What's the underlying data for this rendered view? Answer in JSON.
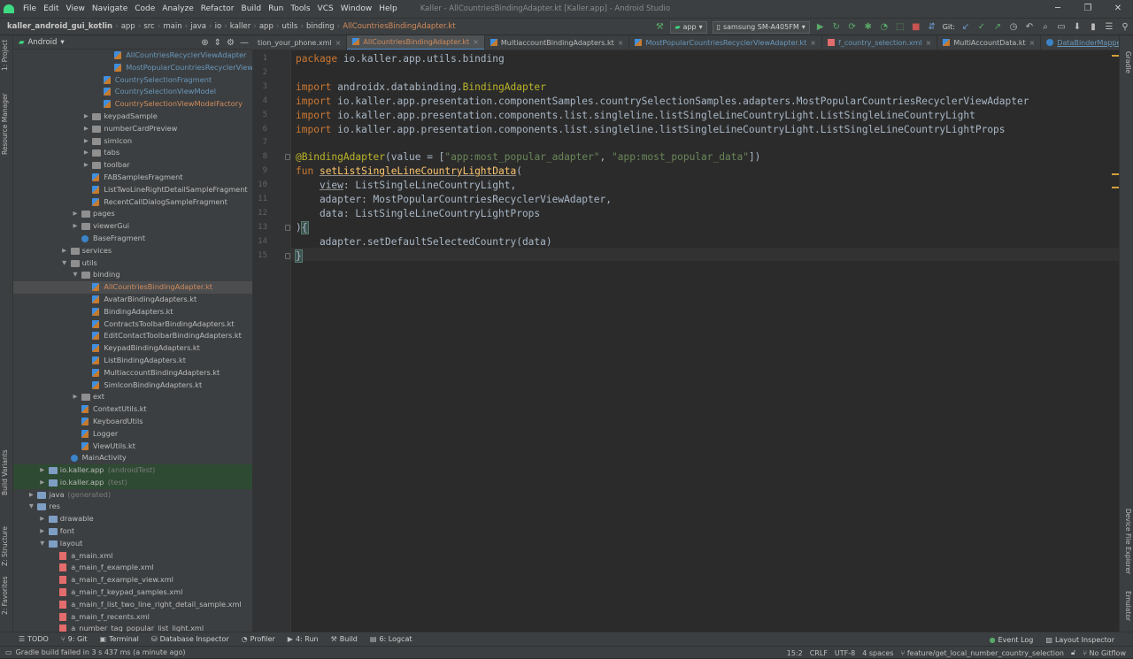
{
  "menubar": {
    "items": [
      "File",
      "Edit",
      "View",
      "Navigate",
      "Code",
      "Analyze",
      "Refactor",
      "Build",
      "Run",
      "Tools",
      "VCS",
      "Window",
      "Help"
    ],
    "window_title": "Kaller - AllCountriesBindingAdapter.kt [Kaller.app] - Android Studio"
  },
  "breadcrumbs": [
    "kaller_android_gui_kotlin",
    "app",
    "src",
    "main",
    "java",
    "io",
    "kaller",
    "app",
    "utils",
    "binding",
    "AllCountriesBindingAdapter.kt"
  ],
  "toolbar": {
    "run_config": "app",
    "device": "samsung SM-A405FM",
    "git_label": "Git:"
  },
  "project_panel": {
    "view_mode": "Android",
    "rows": [
      {
        "label": "AllCountriesRecyclerViewAdapter",
        "indent": 8,
        "icon": "kt",
        "color": "blue",
        "arrow": ""
      },
      {
        "label": "MostPopularCountriesRecyclerViewAdapte",
        "indent": 8,
        "icon": "kt",
        "color": "blue",
        "arrow": ""
      },
      {
        "label": "CountrySelectionFragment",
        "indent": 7,
        "icon": "kt",
        "color": "blue",
        "arrow": ""
      },
      {
        "label": "CountrySelectionViewModel",
        "indent": 7,
        "icon": "kt",
        "color": "blue",
        "arrow": ""
      },
      {
        "label": "CountrySelectionViewModelFactory",
        "indent": 7,
        "icon": "kt",
        "color": "orange",
        "arrow": ""
      },
      {
        "label": "keypadSample",
        "indent": 6,
        "icon": "folder",
        "color": "",
        "arrow": "▶"
      },
      {
        "label": "numberCardPreview",
        "indent": 6,
        "icon": "folder",
        "color": "",
        "arrow": "▶"
      },
      {
        "label": "simIcon",
        "indent": 6,
        "icon": "folder",
        "color": "",
        "arrow": "▶"
      },
      {
        "label": "tabs",
        "indent": 6,
        "icon": "folder",
        "color": "",
        "arrow": "▶"
      },
      {
        "label": "toolbar",
        "indent": 6,
        "icon": "folder",
        "color": "",
        "arrow": "▶"
      },
      {
        "label": "FABSamplesFragment",
        "indent": 6,
        "icon": "kt",
        "color": "",
        "arrow": ""
      },
      {
        "label": "ListTwoLineRightDetailSampleFragment",
        "indent": 6,
        "icon": "kt",
        "color": "",
        "arrow": ""
      },
      {
        "label": "RecentCallDialogSampleFragment",
        "indent": 6,
        "icon": "kt",
        "color": "",
        "arrow": ""
      },
      {
        "label": "pages",
        "indent": 5,
        "icon": "folder",
        "color": "",
        "arrow": "▶"
      },
      {
        "label": "viewerGui",
        "indent": 5,
        "icon": "folder",
        "color": "",
        "arrow": "▶"
      },
      {
        "label": "BaseFragment",
        "indent": 5,
        "icon": "cls",
        "color": "",
        "arrow": ""
      },
      {
        "label": "services",
        "indent": 4,
        "icon": "folder",
        "color": "",
        "arrow": "▶"
      },
      {
        "label": "utils",
        "indent": 4,
        "icon": "folder",
        "color": "",
        "arrow": "▼"
      },
      {
        "label": "binding",
        "indent": 5,
        "icon": "folder",
        "color": "",
        "arrow": "▼"
      },
      {
        "label": "AllCountriesBindingAdapter.kt",
        "indent": 6,
        "icon": "kt",
        "color": "orange",
        "arrow": "",
        "selected": true
      },
      {
        "label": "AvatarBindingAdapters.kt",
        "indent": 6,
        "icon": "kt",
        "color": "",
        "arrow": ""
      },
      {
        "label": "BindingAdapters.kt",
        "indent": 6,
        "icon": "kt",
        "color": "",
        "arrow": ""
      },
      {
        "label": "ContractsToolbarBindingAdapters.kt",
        "indent": 6,
        "icon": "kt",
        "color": "",
        "arrow": ""
      },
      {
        "label": "EditContactToolbarBindingAdapters.kt",
        "indent": 6,
        "icon": "kt",
        "color": "",
        "arrow": ""
      },
      {
        "label": "KeypadBindingAdapters.kt",
        "indent": 6,
        "icon": "kt",
        "color": "",
        "arrow": ""
      },
      {
        "label": "ListBindingAdapters.kt",
        "indent": 6,
        "icon": "kt",
        "color": "",
        "arrow": ""
      },
      {
        "label": "MultiaccountBindingAdapters.kt",
        "indent": 6,
        "icon": "kt",
        "color": "",
        "arrow": ""
      },
      {
        "label": "SimIconBindingAdapters.kt",
        "indent": 6,
        "icon": "kt",
        "color": "",
        "arrow": ""
      },
      {
        "label": "ext",
        "indent": 5,
        "icon": "folder",
        "color": "",
        "arrow": "▶"
      },
      {
        "label": "ContextUtils.kt",
        "indent": 5,
        "icon": "kt",
        "color": "",
        "arrow": ""
      },
      {
        "label": "KeyboardUtils",
        "indent": 5,
        "icon": "kt",
        "color": "",
        "arrow": ""
      },
      {
        "label": "Logger",
        "indent": 5,
        "icon": "kt",
        "color": "",
        "arrow": ""
      },
      {
        "label": "ViewUtils.kt",
        "indent": 5,
        "icon": "kt",
        "color": "",
        "arrow": ""
      },
      {
        "label": "MainActivity",
        "indent": 4,
        "icon": "cls",
        "color": "",
        "arrow": ""
      },
      {
        "label": "io.kaller.app",
        "suffix": "(androidTest)",
        "indent": 2,
        "icon": "folder",
        "color": "",
        "arrow": "▶",
        "green": true
      },
      {
        "label": "io.kaller.app",
        "suffix": "(test)",
        "indent": 2,
        "icon": "folder",
        "color": "",
        "arrow": "▶",
        "green": true
      },
      {
        "label": "java",
        "suffix": "(generated)",
        "indent": 1,
        "icon": "folder",
        "color": "",
        "arrow": "▶"
      },
      {
        "label": "res",
        "indent": 1,
        "icon": "folder",
        "color": "",
        "arrow": "▼"
      },
      {
        "label": "drawable",
        "indent": 2,
        "icon": "folder",
        "color": "",
        "arrow": "▶"
      },
      {
        "label": "font",
        "indent": 2,
        "icon": "folder",
        "color": "",
        "arrow": "▶"
      },
      {
        "label": "layout",
        "indent": 2,
        "icon": "folder",
        "color": "",
        "arrow": "▼"
      },
      {
        "label": "a_main.xml",
        "indent": 3,
        "icon": "xml",
        "color": "",
        "arrow": ""
      },
      {
        "label": "a_main_f_example.xml",
        "indent": 3,
        "icon": "xml",
        "color": "",
        "arrow": ""
      },
      {
        "label": "a_main_f_example_view.xml",
        "indent": 3,
        "icon": "xml",
        "color": "",
        "arrow": ""
      },
      {
        "label": "a_main_f_keypad_samples.xml",
        "indent": 3,
        "icon": "xml",
        "color": "",
        "arrow": ""
      },
      {
        "label": "a_main_f_list_two_line_right_detail_sample.xml",
        "indent": 3,
        "icon": "xml",
        "color": "",
        "arrow": ""
      },
      {
        "label": "a_main_f_recents.xml",
        "indent": 3,
        "icon": "xml",
        "color": "",
        "arrow": ""
      },
      {
        "label": "a_number_tag_popular_list_light.xml",
        "indent": 3,
        "icon": "xml",
        "color": "",
        "arrow": ""
      }
    ]
  },
  "editor_tabs": [
    {
      "label": "tion_your_phone.xml",
      "style": "plain"
    },
    {
      "label": "AllCountriesBindingAdapter.kt",
      "style": "active"
    },
    {
      "label": "MultiaccountBindingAdapters.kt",
      "style": "plain"
    },
    {
      "label": "MostPopularCountriesRecyclerViewAdapter.kt",
      "style": "blue"
    },
    {
      "label": "f_country_selection.xml",
      "style": "blue"
    },
    {
      "label": "MultiAccountData.kt",
      "style": "plain"
    },
    {
      "label": "DataBinderMapperImpl.java",
      "style": "under"
    }
  ],
  "code": {
    "line_numbers": [
      "1",
      "2",
      "3",
      "4",
      "5",
      "6",
      "7",
      "8",
      "9",
      "10",
      "11",
      "12",
      "13",
      "14",
      "15"
    ],
    "lines": [
      [
        [
          "kw",
          "package "
        ],
        [
          "",
          "io.kaller.app.utils.binding"
        ]
      ],
      [],
      [
        [
          "kw",
          "import "
        ],
        [
          "",
          "androidx.databinding."
        ],
        [
          "an",
          "BindingAdapter"
        ]
      ],
      [
        [
          "kw",
          "import "
        ],
        [
          "",
          "io.kaller.app.presentation.componentSamples.countrySelectionSamples.adapters.MostPopularCountriesRecyclerViewAdapter"
        ]
      ],
      [
        [
          "kw",
          "import "
        ],
        [
          "",
          "io.kaller.app.presentation.components.list.singleline.listSingleLineCountryLight.ListSingleLineCountryLight"
        ]
      ],
      [
        [
          "kw",
          "import "
        ],
        [
          "",
          "io.kaller.app.presentation.components.list.singleline.listSingleLineCountryLight.ListSingleLineCountryLightProps"
        ]
      ],
      [],
      [
        [
          "an",
          "@BindingAdapter"
        ],
        [
          "",
          "(value = ["
        ],
        [
          "str",
          "\"app:most_popular_adapter\""
        ],
        [
          "",
          ", "
        ],
        [
          "str",
          "\"app:most_popular_data\""
        ],
        [
          "",
          "])"
        ]
      ],
      [
        [
          "kw",
          "fun "
        ],
        [
          "fn",
          "setListSingleLineCountryLightData"
        ],
        [
          "",
          "("
        ]
      ],
      [
        [
          "",
          "    "
        ],
        [
          "par",
          "view"
        ],
        [
          "",
          ": ListSingleLineCountryLight,"
        ]
      ],
      [
        [
          "",
          "    adapter: MostPopularCountriesRecyclerViewAdapter,"
        ]
      ],
      [
        [
          "",
          "    data: ListSingleLineCountryLightProps"
        ]
      ],
      [
        [
          "",
          ")"
        ],
        [
          "br",
          "{"
        ]
      ],
      [
        [
          "",
          "    adapter.setDefaultSelectedCountry(data)"
        ]
      ],
      [
        [
          "br",
          "}"
        ]
      ]
    ]
  },
  "left_strip_tabs": [
    "1: Project",
    "Resource Manager",
    "Build Variants",
    "Z: Structure",
    "2: Favorites"
  ],
  "right_strip_tabs": [
    "Gradle",
    "Device File Explorer",
    "Emulator"
  ],
  "bottom_tools": [
    {
      "icon": "list-icon",
      "label": "TODO"
    },
    {
      "icon": "git-icon",
      "label": "9: Git"
    },
    {
      "icon": "terminal-icon",
      "label": "Terminal"
    },
    {
      "icon": "database-icon",
      "label": "Database Inspector"
    },
    {
      "icon": "profiler-icon",
      "label": "Profiler"
    },
    {
      "icon": "run-icon",
      "label": "4: Run"
    },
    {
      "icon": "hammer-icon",
      "label": "Build"
    },
    {
      "icon": "logcat-icon",
      "label": "6: Logcat"
    }
  ],
  "bottom_tools_right": [
    {
      "icon": "event-log-icon",
      "label": "Event Log"
    },
    {
      "icon": "layout-inspector-icon",
      "label": "Layout Inspector"
    }
  ],
  "status": {
    "message": "Gradle build failed in 3 s 437 ms (a minute ago)",
    "position": "15:2",
    "line_sep": "CRLF",
    "encoding": "UTF-8",
    "indent": "4 spaces",
    "branch": "feature/get_local_number_country_selection",
    "gitflow": "No Gitflow"
  },
  "colors": {
    "accent": "#4a88c7",
    "keyword": "#cc7832",
    "annotation": "#bbb529",
    "string": "#6a8759",
    "function": "#ffc66d",
    "selected_file": "#d08b5c"
  }
}
